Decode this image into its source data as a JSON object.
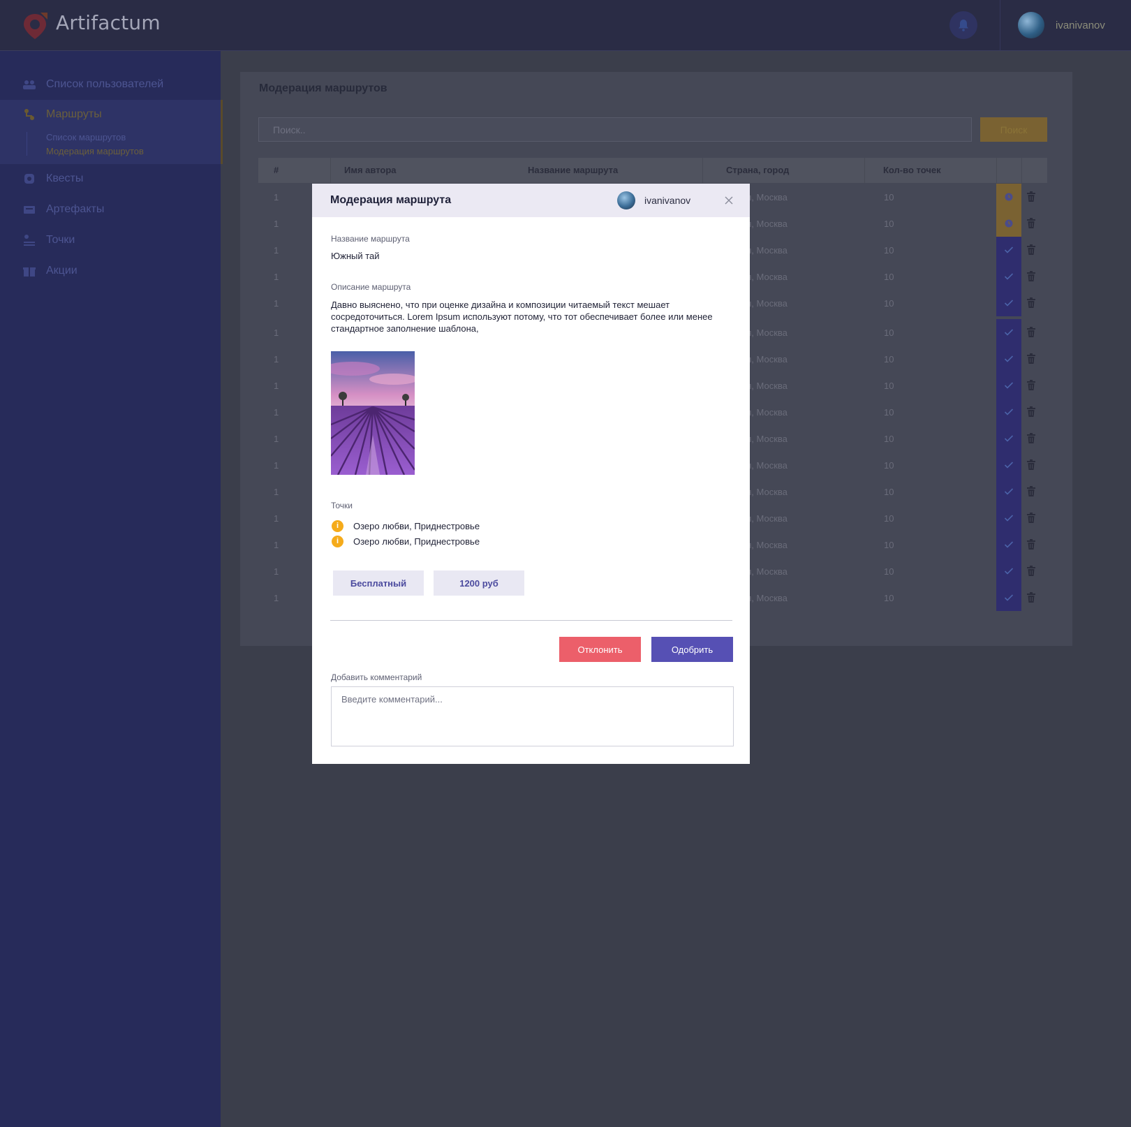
{
  "header": {
    "app_name": "Artifactum",
    "username": "ivanivanov",
    "logo_icon": "location-pin-arrow-icon",
    "bell_icon": "bell-icon"
  },
  "sidebar": {
    "items": [
      {
        "label": "Список пользователей",
        "icon": "users-icon"
      },
      {
        "label": "Маршруты",
        "icon": "route-icon"
      },
      {
        "label": "Квесты",
        "icon": "quest-icon"
      },
      {
        "label": "Артефакты",
        "icon": "artifact-icon"
      },
      {
        "label": "Точки",
        "icon": "points-icon"
      },
      {
        "label": "Акции",
        "icon": "gift-icon"
      }
    ],
    "sub_items": [
      "Список маршрутов",
      "Модерация маршрутов"
    ],
    "active_color": "#f5ab1b"
  },
  "main": {
    "title": "Модерация маршрутов",
    "search_placeholder": "Поиск..",
    "search_button": "Поиск",
    "columns": [
      "#",
      "Имя автора",
      "Название маршрута",
      "Страна, город",
      "Кол-во точек"
    ],
    "rows": [
      {
        "num": "1",
        "city": "ия, Москва",
        "points": "10",
        "status": "pending"
      },
      {
        "num": "1",
        "city": "ия, Москва",
        "points": "10",
        "status": "pending"
      },
      {
        "num": "1",
        "city": "ия, Москва",
        "points": "10",
        "status": "approved"
      },
      {
        "num": "1",
        "city": "ия, Москва",
        "points": "10",
        "status": "approved"
      },
      {
        "num": "1",
        "city": "ия, Москва",
        "points": "10",
        "status": "approved"
      },
      {
        "num": "1",
        "city": "ия, Москва",
        "points": "10",
        "status": "approved"
      },
      {
        "num": "1",
        "city": "ия, Москва",
        "points": "10",
        "status": "approved"
      },
      {
        "num": "1",
        "city": "ия, Москва",
        "points": "10",
        "status": "approved"
      },
      {
        "num": "1",
        "city": "ия, Москва",
        "points": "10",
        "status": "approved"
      },
      {
        "num": "1",
        "city": "ия, Москва",
        "points": "10",
        "status": "approved"
      },
      {
        "num": "1",
        "city": "ия, Москва",
        "points": "10",
        "status": "approved"
      },
      {
        "num": "1",
        "city": "ия, Москва",
        "points": "10",
        "status": "approved"
      },
      {
        "num": "1",
        "city": "ия, Москва",
        "points": "10",
        "status": "approved"
      },
      {
        "num": "1",
        "city": "ия, Москва",
        "points": "10",
        "status": "approved"
      },
      {
        "num": "1",
        "city": "ия, Москва",
        "points": "10",
        "status": "approved"
      },
      {
        "num": "1",
        "city": "ия, Москва",
        "points": "10",
        "status": "approved"
      }
    ]
  },
  "modal": {
    "title": "Модерация маршрута",
    "username": "ivanivanov",
    "route_name_label": "Название маршрута",
    "route_name": "Южный тай",
    "description_label": "Описание маршрута",
    "description": "Давно выяснено, что при оценке дизайна и композиции читаемый текст мешает сосредоточиться. Lorem Ipsum используют потому, что тот обеспечивает более или менее стандартное заполнение шаблона,",
    "photo": "lavender-field-photo",
    "points_label": "Точки",
    "points": [
      "Озеро любви, Приднестровье",
      "Озеро любви, Приднестровье"
    ],
    "tags": [
      "Бесплатный",
      "1200 руб"
    ],
    "reject_button": "Отклонить",
    "approve_button": "Одобрить",
    "comment_label": "Добавить комментарий",
    "comment_placeholder": "Введите комментарий...",
    "colors": {
      "reject": "#ec5f6a",
      "approve": "#5650b4",
      "point_icon": "#f5ab1b"
    }
  }
}
